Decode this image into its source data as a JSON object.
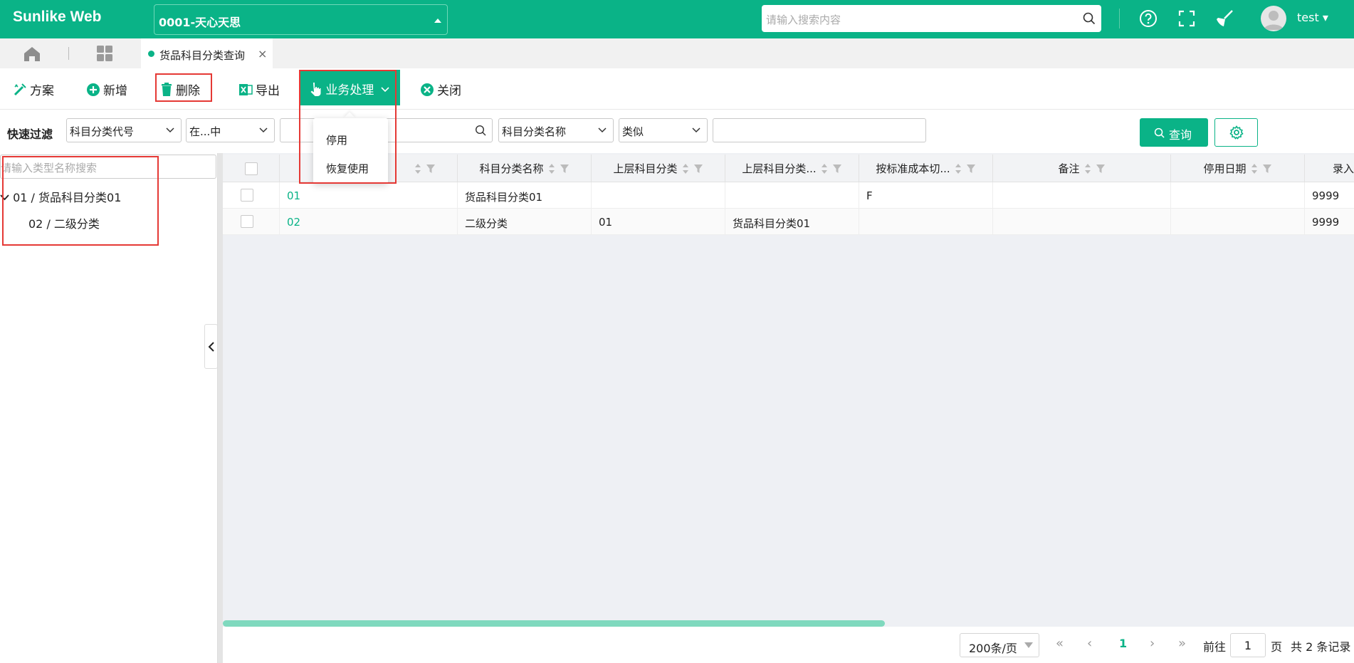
{
  "header": {
    "brand": "Sunlike Web",
    "company": "0001-天心天思",
    "search_placeholder": "请输入搜索内容",
    "user": "test ▾"
  },
  "tabs": {
    "active": "货品科目分类查询",
    "close": "×"
  },
  "toolbar": {
    "scheme": "方案",
    "add": "新增",
    "delete": "删除",
    "export": "导出",
    "business": "业务处理",
    "close": "关闭"
  },
  "business_menu": [
    "停用",
    "恢复使用"
  ],
  "filter": {
    "label": "快速过滤",
    "field1": "科目分类代号",
    "op1": "在...中",
    "value1": "",
    "field2": "科目分类名称",
    "op2": "类似",
    "value2": "",
    "query": "查询"
  },
  "tree": {
    "search_placeholder": "请输入类型名称搜索",
    "nodes": [
      "01 / 货品科目分类01",
      "02 / 二级分类"
    ]
  },
  "grid": {
    "columns": [
      "科目分类名称",
      "上层科目分类",
      "上层科目分类...",
      "按标准成本切...",
      "备注",
      "停用日期",
      "录入"
    ],
    "rows": [
      {
        "code": "01",
        "name": "货品科目分类01",
        "parent": "",
        "parent_name": "",
        "std": "F",
        "remark": "",
        "stop": "",
        "entry": "9999"
      },
      {
        "code": "02",
        "name": "二级分类",
        "parent": "01",
        "parent_name": "货品科目分类01",
        "std": "",
        "remark": "",
        "stop": "",
        "entry": "9999"
      }
    ]
  },
  "pager": {
    "page_size": "200条/页",
    "current": "1",
    "goto_label": "前往",
    "goto_value": "1",
    "page_unit": "页",
    "total": "共 2 条记录"
  },
  "colors": {
    "primary": "#0ab387",
    "highlight": "#e53935"
  }
}
